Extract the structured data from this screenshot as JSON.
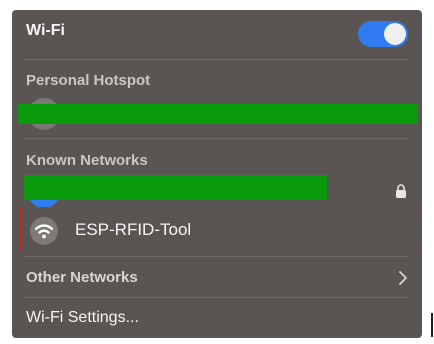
{
  "wifi": {
    "title": "Wi-Fi",
    "enabled": true,
    "accent_color": "#2f7bf0"
  },
  "sections": {
    "personal_hotspot": "Personal Hotspot",
    "known_networks": "Known Networks"
  },
  "redaction_color": "#089a0a",
  "networks": {
    "esp": {
      "name": "ESP-RFID-Tool",
      "icon": "wifi-icon",
      "highlight_color": "#c42a2a"
    },
    "known_first": {
      "icon": "lock-icon"
    }
  },
  "other_networks": {
    "label": "Other Networks",
    "icon": "chevron-right-icon"
  },
  "settings": {
    "label": "Wi-Fi Settings..."
  }
}
